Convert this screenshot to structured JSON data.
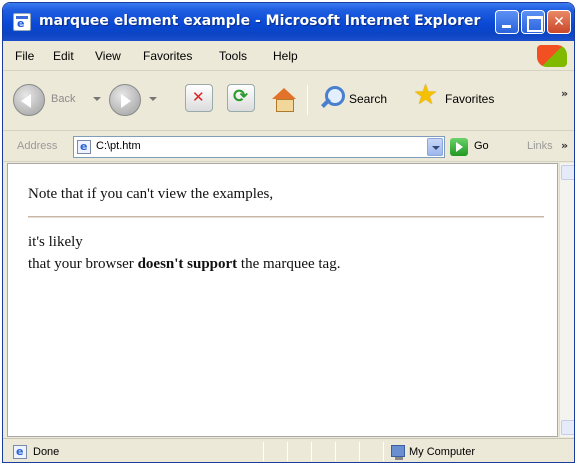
{
  "window": {
    "title": "marquee element example - Microsoft Internet Explorer"
  },
  "menu": {
    "items": [
      {
        "label": "File"
      },
      {
        "label": "Edit"
      },
      {
        "label": "View"
      },
      {
        "label": "Favorites"
      },
      {
        "label": "Tools"
      },
      {
        "label": "Help"
      }
    ]
  },
  "toolbar": {
    "back_label": "Back",
    "search_label": "Search",
    "favorites_label": "Favorites"
  },
  "address": {
    "label": "Address",
    "value": "C:\\pt.htm",
    "go_label": "Go",
    "links_label": "Links"
  },
  "content": {
    "line1": "Note that if you can't view the examples,",
    "line2": "it's likely",
    "line3_before": "that your browser ",
    "line3_bold": "doesn't support",
    "line3_after": " the marquee tag."
  },
  "status": {
    "text": "Done",
    "zone": "My Computer"
  }
}
